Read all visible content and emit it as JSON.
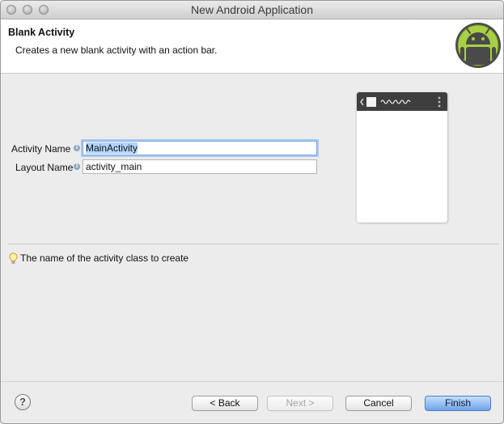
{
  "window": {
    "title": "New Android Application"
  },
  "header": {
    "title": "Blank Activity",
    "description": "Creates a new blank activity with an action bar."
  },
  "form": {
    "activity_name": {
      "label": "Activity Name",
      "value": "MainActivity"
    },
    "layout_name": {
      "label": "Layout Name",
      "value": "activity_main"
    }
  },
  "hint": {
    "text": "The name of the activity class to create"
  },
  "buttons": {
    "help": "?",
    "back": "< Back",
    "next": "Next >",
    "cancel": "Cancel",
    "finish": "Finish"
  },
  "colors": {
    "primary_button": "#6fa4ea",
    "focus_ring": "#a9c9f0",
    "android_green": "#a4c639"
  },
  "icons": [
    "close-light-icon",
    "minimize-light-icon",
    "zoom-light-icon",
    "android-logo-icon",
    "info-icon",
    "lightbulb-icon",
    "help-icon"
  ]
}
